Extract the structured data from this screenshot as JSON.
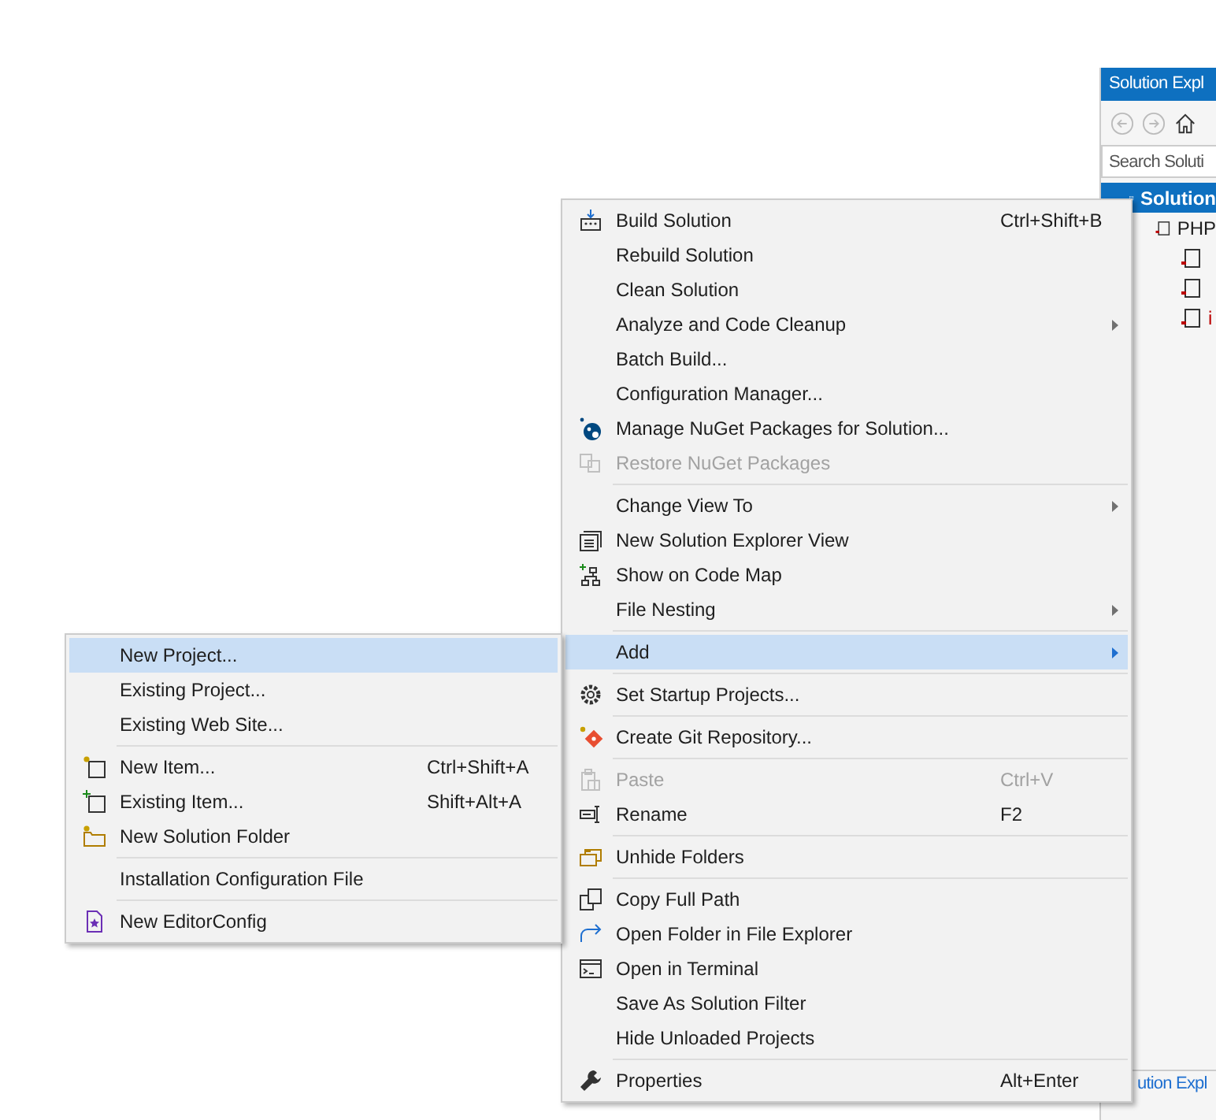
{
  "solution_explorer": {
    "title": "Solution Expl",
    "search": {
      "placeholder": "Search Soluti"
    },
    "tree": [
      {
        "label": "Solution",
        "selected": true,
        "children": [
          {
            "label": "PHP",
            "selected": false,
            "children": [
              {
                "selected": false
              },
              {
                "selected": false
              },
              {
                "label": "i",
                "selected": false
              }
            ]
          }
        ]
      }
    ],
    "footer_tab": "ution Expl"
  },
  "context_menu": {
    "items": [
      {
        "kind": "item",
        "label": "Build Solution",
        "shortcut": "Ctrl+Shift+B",
        "submenu": false,
        "disabled": false,
        "selected": false
      },
      {
        "kind": "item",
        "label": "Rebuild Solution",
        "submenu": false,
        "disabled": false,
        "selected": false
      },
      {
        "kind": "item",
        "label": "Clean Solution",
        "submenu": false,
        "disabled": false,
        "selected": false
      },
      {
        "kind": "item",
        "label": "Analyze and Code Cleanup",
        "submenu": true,
        "disabled": false,
        "selected": false
      },
      {
        "kind": "item",
        "label": "Batch Build...",
        "submenu": false,
        "disabled": false,
        "selected": false
      },
      {
        "kind": "item",
        "label": "Configuration Manager...",
        "submenu": false,
        "disabled": false,
        "selected": false
      },
      {
        "kind": "item",
        "label": "Manage NuGet Packages for Solution...",
        "submenu": false,
        "disabled": false,
        "selected": false
      },
      {
        "kind": "item",
        "label": "Restore NuGet Packages",
        "submenu": false,
        "disabled": true,
        "selected": false
      },
      {
        "kind": "separator"
      },
      {
        "kind": "item",
        "label": "Change View To",
        "submenu": true,
        "disabled": false,
        "selected": false
      },
      {
        "kind": "item",
        "label": "New Solution Explorer View",
        "submenu": false,
        "disabled": false,
        "selected": false
      },
      {
        "kind": "item",
        "label": "Show on Code Map",
        "submenu": false,
        "disabled": false,
        "selected": false
      },
      {
        "kind": "item",
        "label": "File Nesting",
        "submenu": true,
        "disabled": false,
        "selected": false
      },
      {
        "kind": "separator"
      },
      {
        "kind": "item",
        "label": "Add",
        "submenu": true,
        "disabled": false,
        "selected": true
      },
      {
        "kind": "separator"
      },
      {
        "kind": "item",
        "label": "Set Startup Projects...",
        "submenu": false,
        "disabled": false,
        "selected": false
      },
      {
        "kind": "separator"
      },
      {
        "kind": "item",
        "label": "Create Git Repository...",
        "submenu": false,
        "disabled": false,
        "selected": false
      },
      {
        "kind": "separator"
      },
      {
        "kind": "item",
        "label": "Paste",
        "shortcut": "Ctrl+V",
        "submenu": false,
        "disabled": true,
        "selected": false
      },
      {
        "kind": "item",
        "label": "Rename",
        "shortcut": "F2",
        "submenu": false,
        "disabled": false,
        "selected": false
      },
      {
        "kind": "separator"
      },
      {
        "kind": "item",
        "label": "Unhide Folders",
        "submenu": false,
        "disabled": false,
        "selected": false
      },
      {
        "kind": "separator"
      },
      {
        "kind": "item",
        "label": "Copy Full Path",
        "submenu": false,
        "disabled": false,
        "selected": false
      },
      {
        "kind": "item",
        "label": "Open Folder in File Explorer",
        "submenu": false,
        "disabled": false,
        "selected": false
      },
      {
        "kind": "item",
        "label": "Open in Terminal",
        "submenu": false,
        "disabled": false,
        "selected": false
      },
      {
        "kind": "item",
        "label": "Save As Solution Filter",
        "submenu": false,
        "disabled": false,
        "selected": false
      },
      {
        "kind": "item",
        "label": "Hide Unloaded Projects",
        "submenu": false,
        "disabled": false,
        "selected": false
      },
      {
        "kind": "separator"
      },
      {
        "kind": "item",
        "label": "Properties",
        "shortcut": "Alt+Enter",
        "submenu": false,
        "disabled": false,
        "selected": false
      }
    ]
  },
  "add_submenu": {
    "items": [
      {
        "kind": "item",
        "label": "New Project...",
        "disabled": false,
        "selected": true
      },
      {
        "kind": "item",
        "label": "Existing Project...",
        "disabled": false,
        "selected": false
      },
      {
        "kind": "item",
        "label": "Existing Web Site...",
        "disabled": false,
        "selected": false
      },
      {
        "kind": "separator"
      },
      {
        "kind": "item",
        "label": "New Item...",
        "shortcut": "Ctrl+Shift+A",
        "disabled": false,
        "selected": false
      },
      {
        "kind": "item",
        "label": "Existing Item...",
        "shortcut": "Shift+Alt+A",
        "disabled": false,
        "selected": false
      },
      {
        "kind": "item",
        "label": "New Solution Folder",
        "disabled": false,
        "selected": false
      },
      {
        "kind": "separator"
      },
      {
        "kind": "item",
        "label": "Installation Configuration File",
        "disabled": false,
        "selected": false
      },
      {
        "kind": "separator"
      },
      {
        "kind": "item",
        "label": "New EditorConfig",
        "disabled": false,
        "selected": false
      }
    ]
  }
}
